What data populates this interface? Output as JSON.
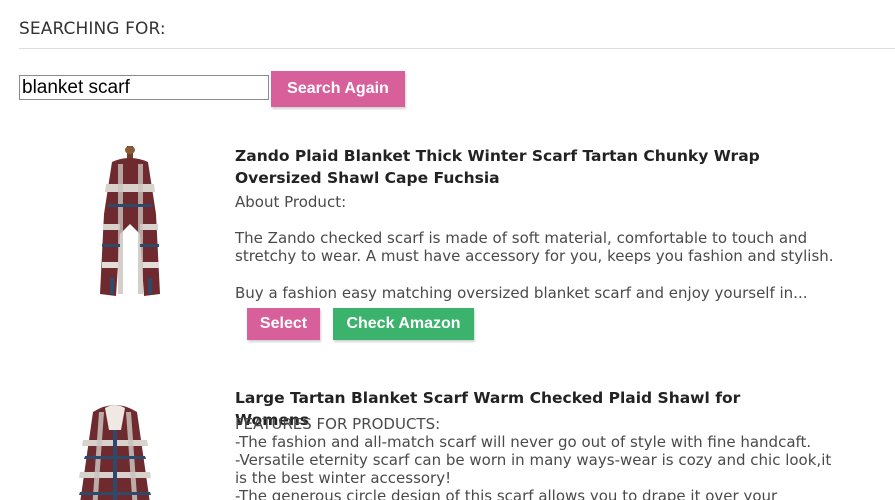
{
  "header": {
    "label": "SEARCHING FOR:"
  },
  "search": {
    "value": "blanket scarf",
    "button_label": "Search Again"
  },
  "products": [
    {
      "title": "Zando Plaid Blanket Thick Winter Scarf Tartan Chunky Wrap Oversized Shawl Cape Fuchsia",
      "about_label": "About Product:",
      "para1": "The Zando checked scarf is made of soft material, comfortable to touch and stretchy to wear. A must have accessory for you, keeps you fashion and stylish.",
      "para2": "Buy a fashion easy matching oversized blanket scarf and enjoy yourself in...",
      "select_label": "Select",
      "amazon_label": "Check Amazon",
      "image": "plaid-scarf-on-mannequin"
    },
    {
      "title": "Large Tartan Blanket Scarf Warm Checked Plaid Shawl for Womens",
      "features": "FEATURES FOR PRODUCTS:\n-The fashion and all-match scarf will never go out of style with fine handcaft.\n-Versatile eternity scarf can be worn in many ways-wear is cozy and chic look,it is the best winter accessory!\n-The generous circle design of this scarf allows you to drape it over your",
      "image": "tartan-shawl-on-mannequin"
    }
  ],
  "colors": {
    "pink_button": "#d8609a",
    "green_button": "#3bb36d"
  }
}
